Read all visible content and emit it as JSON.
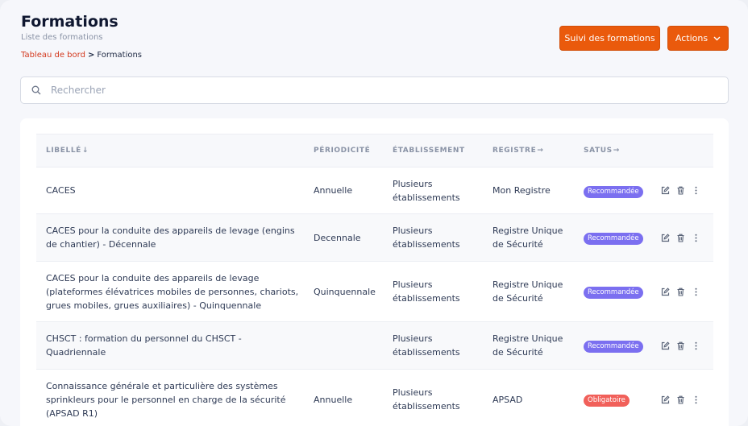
{
  "header": {
    "title": "Formations",
    "subtitle": "Liste des formations",
    "breadcrumb": {
      "link": "Tableau de bord",
      "separator": ">",
      "current": "Formations"
    }
  },
  "buttons": {
    "suivi_label": "Suivi des formations",
    "actions_label": "Actions"
  },
  "search": {
    "placeholder": "Rechercher",
    "value": ""
  },
  "table": {
    "columns": {
      "libelle": "LIBELLÉ",
      "periodicite": "PÉRIODICITÉ",
      "etablissement": "ÉTABLISSEMENT",
      "registre": "REGISTRE",
      "statut": "SATUS"
    },
    "rows": [
      {
        "libelle": "CACES",
        "periodicite": "Annuelle",
        "etablissement": "Plusieurs établissements",
        "registre": "Mon Registre",
        "statut": "Recommandée"
      },
      {
        "libelle": "CACES pour la conduite des appareils de levage (engins de chantier) - Décennale",
        "periodicite": "Decennale",
        "etablissement": "Plusieurs établissements",
        "registre": "Registre Unique de Sécurité",
        "statut": "Recommandée"
      },
      {
        "libelle": "CACES pour la conduite des appareils de levage (plateformes élévatrices mobiles de personnes, chariots, grues mobiles, grues auxiliaires) - Quinquennale",
        "periodicite": "Quinquennale",
        "etablissement": "Plusieurs établissements",
        "registre": "Registre Unique de Sécurité",
        "statut": "Recommandée"
      },
      {
        "libelle": "CHSCT : formation du personnel du CHSCT - Quadriennale",
        "periodicite": "",
        "etablissement": "Plusieurs établissements",
        "registre": "Registre Unique de Sécurité",
        "statut": "Recommandée"
      },
      {
        "libelle": "Connaissance générale et particulière des systèmes sprinkleurs pour le personnel en charge de la sécurité (APSAD R1)",
        "periodicite": "Annuelle",
        "etablissement": "Plusieurs établissements",
        "registre": "APSAD",
        "statut": "Obligatoire"
      }
    ]
  },
  "colors": {
    "accent": "#ea5a0c",
    "breadcrumb_link": "#d33a1f",
    "badge_recommandee": "#7b6ff0",
    "badge_obligatoire": "#f1605a"
  },
  "icons": {
    "search": "search-icon",
    "actions_chevron": "chevron-down-icon",
    "sort_libelle": "arrow-down-icon",
    "sort_registre": "arrow-right-icon",
    "sort_statut": "arrow-right-icon",
    "row_edit": "edit-icon",
    "row_delete": "trash-icon",
    "row_more": "more-vertical-icon"
  }
}
